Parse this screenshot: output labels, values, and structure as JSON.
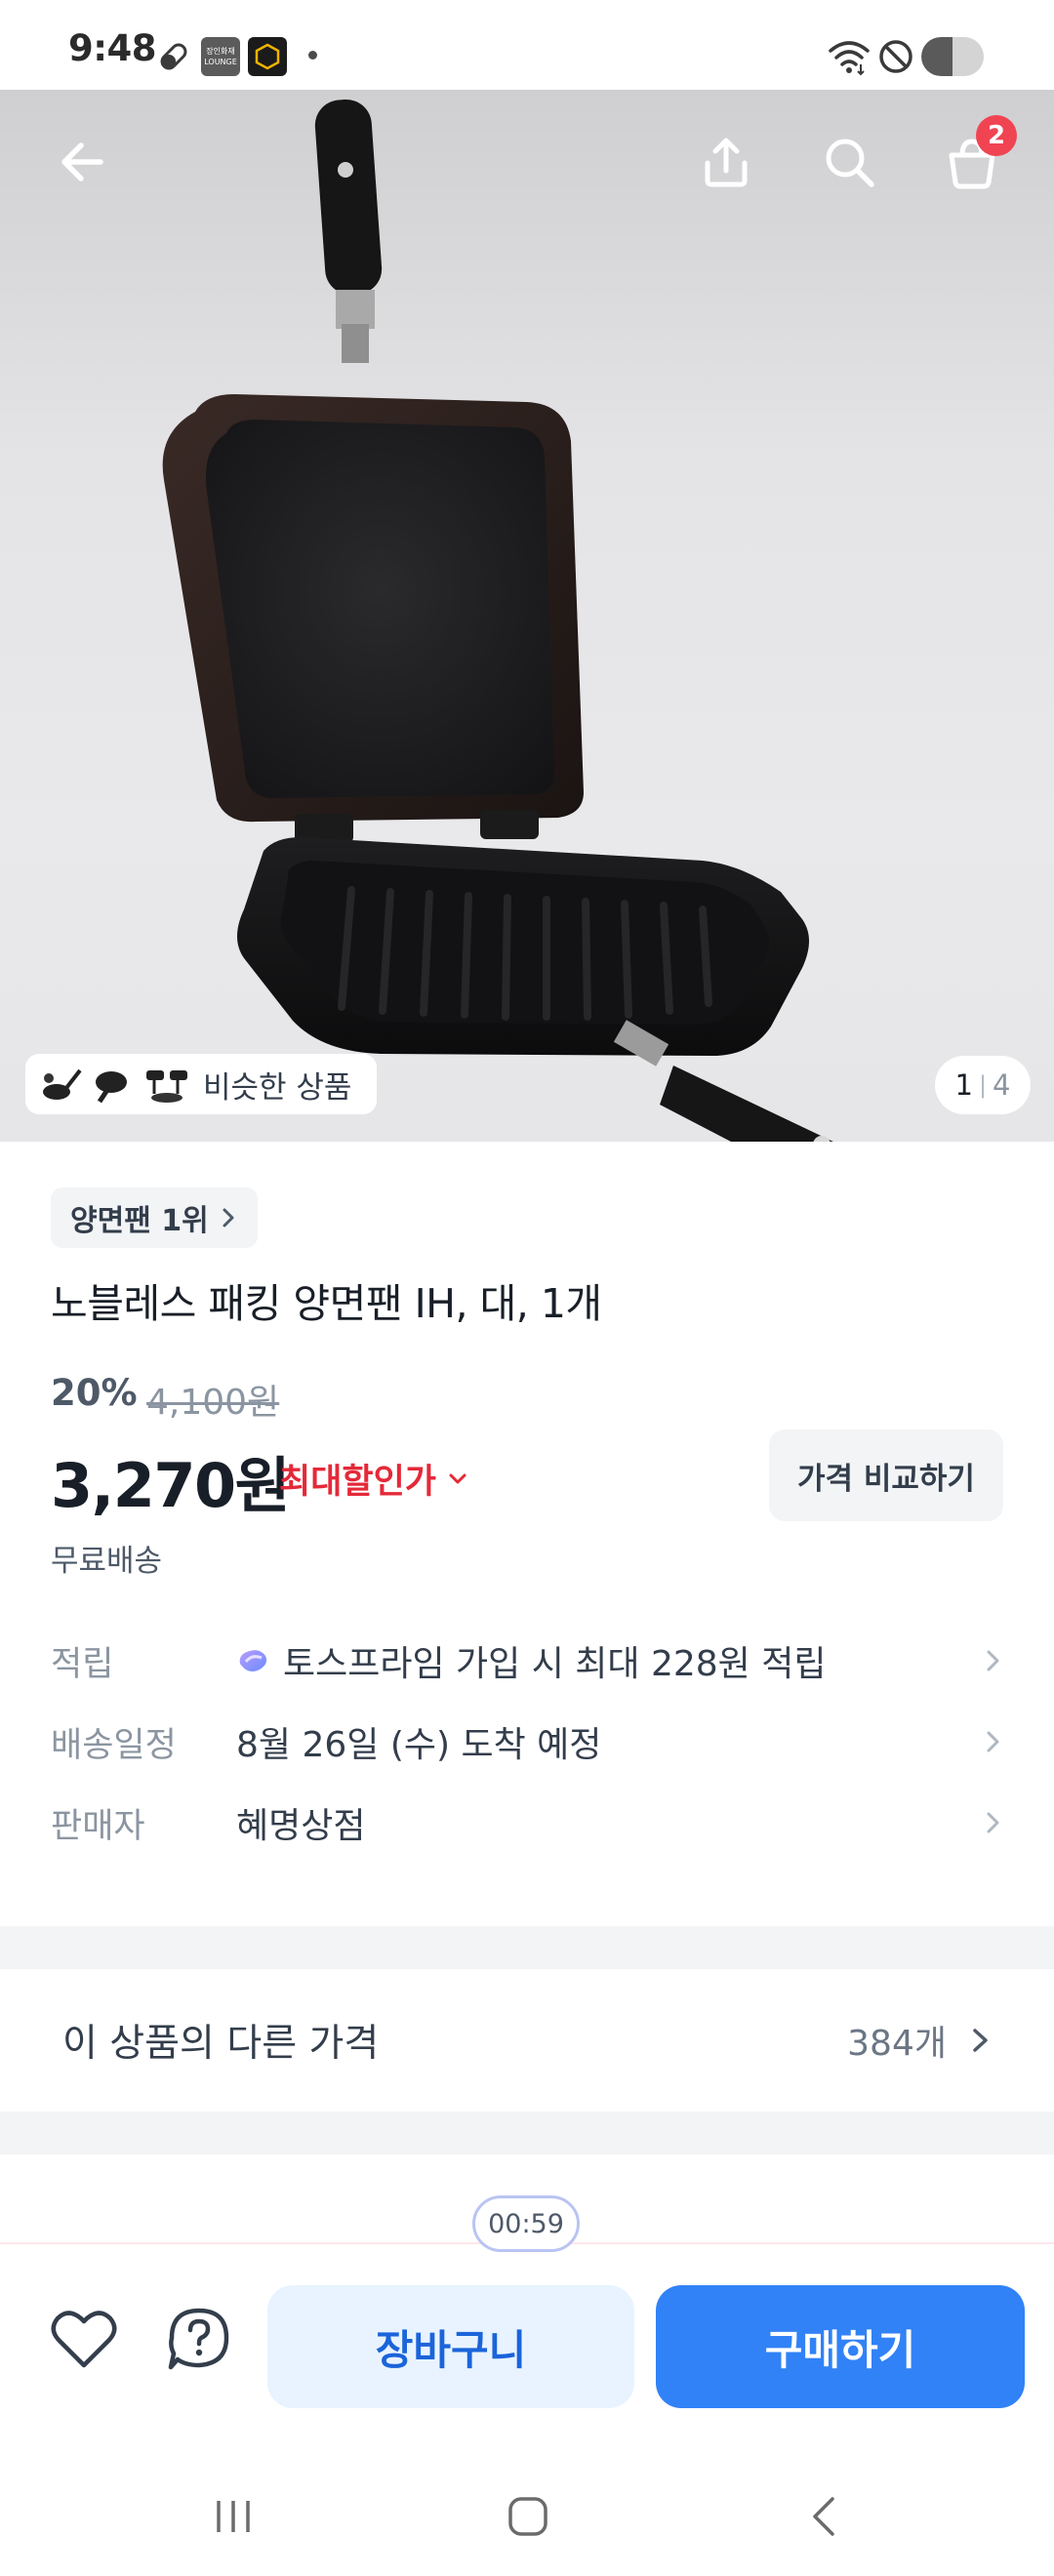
{
  "status_bar": {
    "time": "9:48",
    "app_badge_text": "장인화재 LOUNGE",
    "battery_level": 0.5
  },
  "top_bar": {
    "cart_count": "2"
  },
  "gallery": {
    "similar_label": "비슷한 상품",
    "page_current": "1",
    "page_separator": "|",
    "page_total": "4"
  },
  "product": {
    "rank_chip": "양면팬 1위",
    "title": "노블레스 패킹 양면팬 IH, 대, 1개",
    "discount_rate": "20%",
    "original_price": "4,100원",
    "sale_price": "3,270원",
    "max_discount_label": "최대할인가",
    "compare_button": "가격 비교하기",
    "shipping": "무료배송"
  },
  "info_rows": {
    "points": {
      "label": "적립",
      "value": "토스프라임 가입 시 최대 228원 적립"
    },
    "delivery": {
      "label": "배송일정",
      "value": "8월 26일 (수) 도착 예정"
    },
    "seller": {
      "label": "판매자",
      "value": "혜명상점"
    }
  },
  "other_prices": {
    "label": "이 상품의 다른 가격",
    "count": "384개"
  },
  "timer": "00:59",
  "bottom_bar": {
    "cart_button": "장바구니",
    "buy_button": "구매하기"
  },
  "colors": {
    "primary_blue": "#3182f6",
    "light_blue": "#e8f3ff",
    "discount_red": "#e42939",
    "badge_red": "#f04452"
  },
  "icons": [
    "back-arrow-icon",
    "share-icon",
    "search-icon",
    "cart-icon",
    "heart-icon",
    "help-icon",
    "chevron-right-icon",
    "chevron-down-icon",
    "toss-prime-icon"
  ]
}
